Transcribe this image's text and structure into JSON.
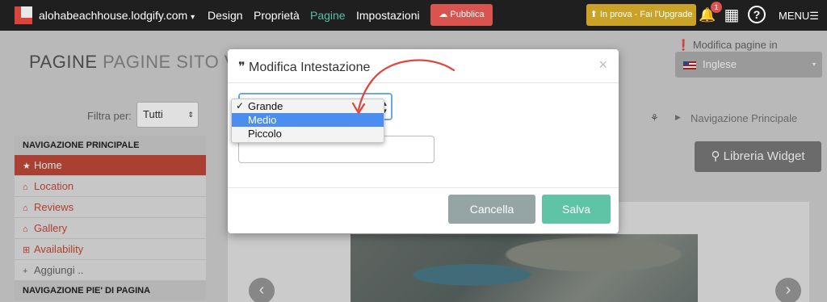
{
  "topbar": {
    "site": "alohabeachhouse.lodgify.com",
    "site_caret": "▾",
    "nav": [
      "Design",
      "Proprietà",
      "Pagine",
      "Impostazioni"
    ],
    "publish_icon": "cloud-upload-icon",
    "publish_label": "☁ Pubblica",
    "trial_label": "⬆ In prova - Fai l'Upgrade",
    "notification_count": "1",
    "bell_glyph": "🔔",
    "calendar_glyph": "▦",
    "help_glyph": "?",
    "menu_label": "MENU☰"
  },
  "page": {
    "title_main": "PAGINE",
    "title_sub": "PAGINE SITO V",
    "lang_warn": "❗",
    "lang_label": "Modifica pagine in",
    "lang_value": "Inglese",
    "lang_caret": "▾",
    "filter_label": "Filtra per:",
    "filter_value": "Tutti",
    "filter_caret": "⇕"
  },
  "sidebar": {
    "main_header": "NAVIGAZIONE PRINCIPALE",
    "items": [
      {
        "icon": "★",
        "label": "Home"
      },
      {
        "icon": "⌂",
        "label": "Location"
      },
      {
        "icon": "⌂",
        "label": "Reviews"
      },
      {
        "icon": "⌂",
        "label": "Gallery"
      },
      {
        "icon": "⊞",
        "label": "Availability"
      }
    ],
    "add_icon": "+",
    "add_label": "Aggiungi ..",
    "footer_header": "NAVIGAZIONE PIE' DI PAGINA"
  },
  "breadcrumb": {
    "icon": "⚘",
    "sep": "▶",
    "label": "Navigazione Principale"
  },
  "widget_button": "⚲ Libreria Widget",
  "preview": {
    "prev": "‹",
    "next": "›"
  },
  "modal": {
    "title": "❞ Modifica Intestazione",
    "close": "×",
    "select_caret": "▲▼",
    "options": [
      "Grande",
      "Medio",
      "Piccolo"
    ],
    "selected": "Grande",
    "highlighted": "Medio",
    "check": "✓",
    "cancel_label": "Cancella",
    "save_label": "Salva"
  },
  "colors": {
    "accent_red": "#c24939",
    "save_green": "#5ec4a5",
    "highlight_blue": "#4b8ef0",
    "annotation_arrow": "#e0443a"
  }
}
